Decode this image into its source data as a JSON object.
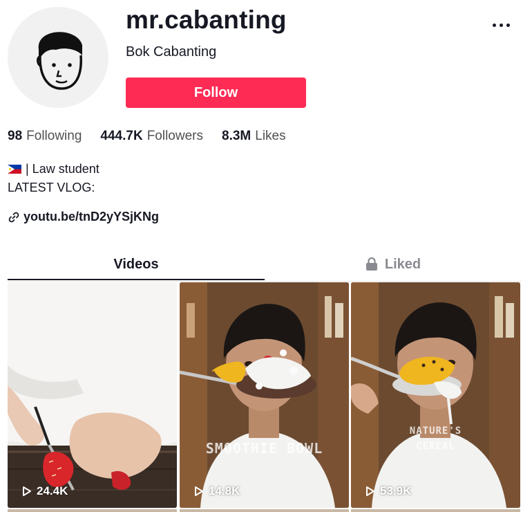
{
  "profile": {
    "username": "mr.cabanting",
    "nickname": "Bok Cabanting",
    "follow_label": "Follow",
    "more_icon": "ellipsis-icon"
  },
  "stats": {
    "following_count": "98",
    "following_label": "Following",
    "followers_count": "444.7K",
    "followers_label": "Followers",
    "likes_count": "8.3M",
    "likes_label": "Likes"
  },
  "bio": {
    "line1": "| Law student",
    "line2": "LATEST VLOG:",
    "flag_icon": "philippines-flag-icon",
    "link_icon": "link-icon",
    "link_text": "youtu.be/tnD2yYSjKNg"
  },
  "tabs": [
    {
      "label": "Videos",
      "active": true
    },
    {
      "label": "Liked",
      "active": false,
      "icon": "lock-icon"
    }
  ],
  "videos": [
    {
      "views": "24.4K",
      "overlay": ""
    },
    {
      "views": "14.8K",
      "overlay": "SMOOTHIE BOWL"
    },
    {
      "views": "53.9K",
      "overlay_line1": "NATURE'S",
      "overlay_line2": "CEREAL"
    }
  ],
  "colors": {
    "accent": "#fe2c55",
    "text": "#161823",
    "muted": "#8a8b91"
  }
}
